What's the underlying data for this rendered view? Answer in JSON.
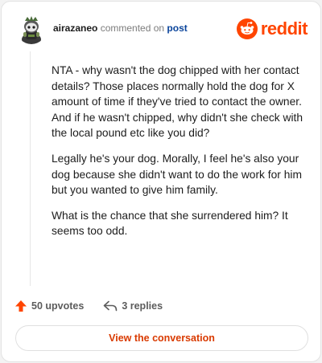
{
  "header": {
    "username": "airazaneo",
    "verb": " commented on ",
    "post_link": "post",
    "brand": "reddit"
  },
  "comment": {
    "paragraphs": [
      "NTA - why wasn't the dog chipped with her contact details? Those places normally hold the dog for X amount of time if they've tried to contact the owner. And if he wasn't chipped, why didn't she check with the local pound etc like you did?",
      "Legally he's your dog. Morally, I feel he's also your dog because she didn't want to do the work for him but you wanted to give him family.",
      "What is the chance that she surrendered him? It seems too odd."
    ]
  },
  "actions": {
    "upvotes": "50 upvotes",
    "replies": "3 replies"
  },
  "cta": {
    "label": "View the conversation"
  },
  "icons": {
    "avatar": "snoo-avatar-icon",
    "logo": "reddit-logo-icon",
    "upvote": "upvote-arrow-icon",
    "reply": "reply-arrow-icon"
  },
  "colors": {
    "brand": "#ff4500",
    "link": "#0a449b",
    "upvote": "#ff4500",
    "cta_text": "#d93a00"
  }
}
